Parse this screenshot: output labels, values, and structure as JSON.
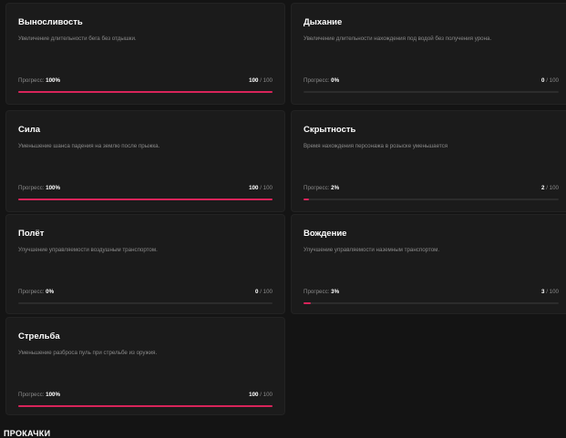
{
  "progress_label": "Прогресс:",
  "cards": [
    {
      "title": "Выносливость",
      "description": "Увеличение длительности бега без отдышки.",
      "progress_pct": "100%",
      "current": "100",
      "max": "/ 100",
      "progress_fraction": 1.0
    },
    {
      "title": "Дыхание",
      "description": "Увеличение длительности нахождения под водой без получения урона.",
      "progress_pct": "0%",
      "current": "0",
      "max": "/ 100",
      "progress_fraction": 0.0
    },
    {
      "title": "Сила",
      "description": "Уменьшение шанса падения на землю после прыжка.",
      "progress_pct": "100%",
      "current": "100",
      "max": "/ 100",
      "progress_fraction": 1.0
    },
    {
      "title": "Скрытность",
      "description": "Время нахождения персонажа в розыске уменьшается",
      "progress_pct": "2%",
      "current": "2",
      "max": "/ 100",
      "progress_fraction": 0.02
    },
    {
      "title": "Полёт",
      "description": "Улучшение управляемости воздушным транспортом.",
      "progress_pct": "0%",
      "current": "0",
      "max": "/ 100",
      "progress_fraction": 0.0
    },
    {
      "title": "Вождение",
      "description": "Улучшение управляемости наземным транспортом.",
      "progress_pct": "3%",
      "current": "3",
      "max": "/ 100",
      "progress_fraction": 0.03
    },
    {
      "title": "Стрельба",
      "description": "Уменьшение разброса пуль при стрельбе из оружия.",
      "progress_pct": "100%",
      "current": "100",
      "max": "/ 100",
      "progress_fraction": 1.0
    }
  ],
  "bottom_heading": "ПРОКАЧКИ",
  "colors": {
    "accent": "#d8245a",
    "background": "#141414",
    "card": "#1b1b1b"
  }
}
